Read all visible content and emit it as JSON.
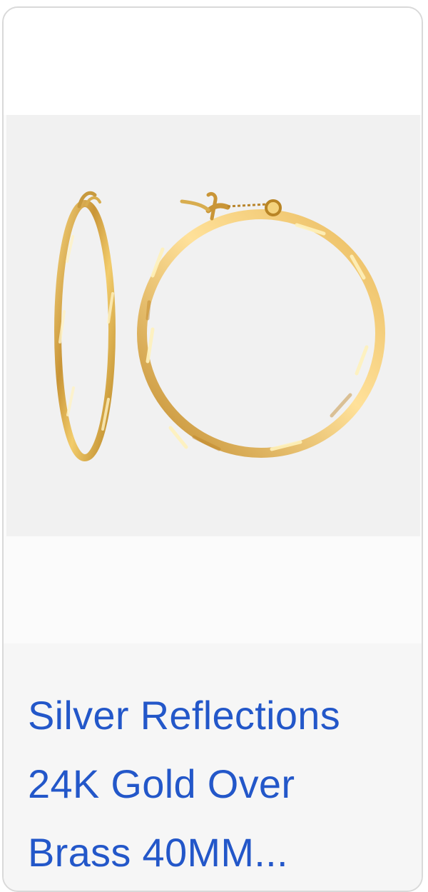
{
  "product": {
    "image": {
      "icon": "gold-hoop-earrings-image",
      "background_color": "#f1f1f1",
      "metal_color": "#d8ad4f"
    },
    "title_lines": [
      "Silver Reflections",
      "24K Gold Over",
      "Brass 40MM..."
    ]
  },
  "colors": {
    "link": "#2357c9",
    "card_border": "#d9d9d9",
    "card_background": "#fbfbfb"
  }
}
